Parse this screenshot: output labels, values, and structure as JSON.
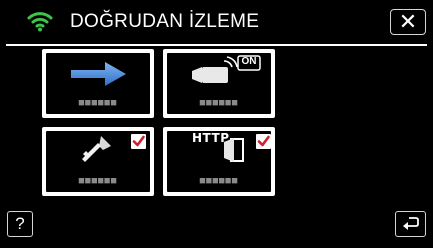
{
  "header": {
    "title": "DOĞRUDAN İZLEME",
    "status_icon": "wifi-icon",
    "close_icon": "close-icon",
    "close_symbol": "✕"
  },
  "tiles": [
    {
      "icon": "arrow-right-icon",
      "caption": "■■■■■■",
      "checked": false
    },
    {
      "icon": "camcorder-wireless-on-icon",
      "badge_text": "ON",
      "caption": "■■■■■■",
      "checked": false
    },
    {
      "icon": "key-icon",
      "caption": "■■■■■■",
      "checked": true
    },
    {
      "icon": "http-door-icon",
      "badge_text": "HTTP",
      "caption": "■■■■■■",
      "checked": true
    }
  ],
  "footer": {
    "help_symbol": "?",
    "help_icon": "help-icon",
    "back_icon": "return-icon"
  },
  "colors": {
    "background": "#000000",
    "accent_green": "#3ec24a",
    "arrow_blue": "#4a8ee0",
    "check_red": "#d0202a",
    "caption_gray": "#8a8a8a"
  }
}
